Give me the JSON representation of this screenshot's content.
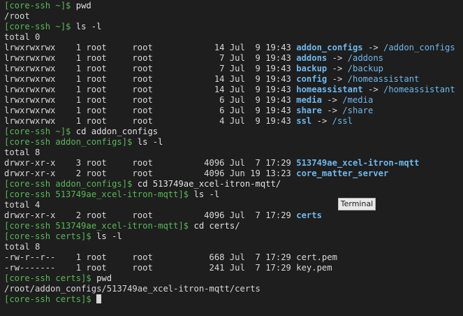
{
  "window": {
    "tooltip": "Terminal"
  },
  "colors": {
    "background": "#1e1e1e",
    "prompt": "#58b858",
    "link": "#6fb8ec",
    "text": "#d8d8d8"
  },
  "lines": [
    {
      "type": "prompt",
      "prompt": "[core-ssh ~]$",
      "command": " pwd"
    },
    {
      "type": "output",
      "text": "/root"
    },
    {
      "type": "prompt",
      "prompt": "[core-ssh ~]$",
      "command": " ls -l"
    },
    {
      "type": "output",
      "text": "total 0"
    },
    {
      "type": "entry",
      "info": "lrwxrwxrwx    1 root     root            14 Jul  9 19:43 ",
      "name": "addon_configs",
      "kind": "link",
      "target": "/addon_configs"
    },
    {
      "type": "entry",
      "info": "lrwxrwxrwx    1 root     root             7 Jul  9 19:43 ",
      "name": "addons",
      "kind": "link",
      "target": "/addons"
    },
    {
      "type": "entry",
      "info": "lrwxrwxrwx    1 root     root             7 Jul  9 19:43 ",
      "name": "backup",
      "kind": "link",
      "target": "/backup"
    },
    {
      "type": "entry",
      "info": "lrwxrwxrwx    1 root     root            14 Jul  9 19:43 ",
      "name": "config",
      "kind": "link",
      "target": "/homeassistant"
    },
    {
      "type": "entry",
      "info": "lrwxrwxrwx    1 root     root            14 Jul  9 19:43 ",
      "name": "homeassistant",
      "kind": "link",
      "target": "/homeassistant"
    },
    {
      "type": "entry",
      "info": "lrwxrwxrwx    1 root     root             6 Jul  9 19:43 ",
      "name": "media",
      "kind": "link",
      "target": "/media"
    },
    {
      "type": "entry",
      "info": "lrwxrwxrwx    1 root     root             6 Jul  9 19:43 ",
      "name": "share",
      "kind": "link",
      "target": "/share"
    },
    {
      "type": "entry",
      "info": "lrwxrwxrwx    1 root     root             4 Jul  9 19:43 ",
      "name": "ssl",
      "kind": "link",
      "target": "/ssl"
    },
    {
      "type": "prompt",
      "prompt": "[core-ssh ~]$",
      "command": " cd addon_configs"
    },
    {
      "type": "prompt",
      "prompt": "[core-ssh addon_configs]$",
      "command": " ls -l"
    },
    {
      "type": "output",
      "text": "total 8"
    },
    {
      "type": "entry",
      "info": "drwxr-xr-x    3 root     root          4096 Jul  7 17:29 ",
      "name": "513749ae_xcel-itron-mqtt",
      "kind": "dir"
    },
    {
      "type": "entry",
      "info": "drwxr-xr-x    2 root     root          4096 Jun 19 13:23 ",
      "name": "core_matter_server",
      "kind": "dir"
    },
    {
      "type": "prompt",
      "prompt": "[core-ssh addon_configs]$",
      "command": " cd 513749ae_xcel-itron-mqtt/"
    },
    {
      "type": "prompt",
      "prompt": "[core-ssh 513749ae_xcel-itron-mqtt]$",
      "command": " ls -l"
    },
    {
      "type": "output",
      "text": "total 4"
    },
    {
      "type": "entry",
      "info": "drwxr-xr-x    2 root     root          4096 Jul  7 17:29 ",
      "name": "certs",
      "kind": "dir"
    },
    {
      "type": "prompt",
      "prompt": "[core-ssh 513749ae_xcel-itron-mqtt]$",
      "command": " cd certs/"
    },
    {
      "type": "prompt",
      "prompt": "[core-ssh certs]$",
      "command": " ls -l"
    },
    {
      "type": "output",
      "text": "total 8"
    },
    {
      "type": "entry",
      "info": "-rw-r--r--    1 root     root           668 Jul  7 17:29 ",
      "name": "cert.pem",
      "kind": "file"
    },
    {
      "type": "entry",
      "info": "-rw-------    1 root     root           241 Jul  7 17:29 ",
      "name": "key.pem",
      "kind": "file"
    },
    {
      "type": "prompt",
      "prompt": "[core-ssh certs]$",
      "command": " pwd"
    },
    {
      "type": "output",
      "text": "/root/addon_configs/513749ae_xcel-itron-mqtt/certs"
    },
    {
      "type": "prompt",
      "prompt": "[core-ssh certs]$",
      "command": " ",
      "cursor": true
    }
  ]
}
